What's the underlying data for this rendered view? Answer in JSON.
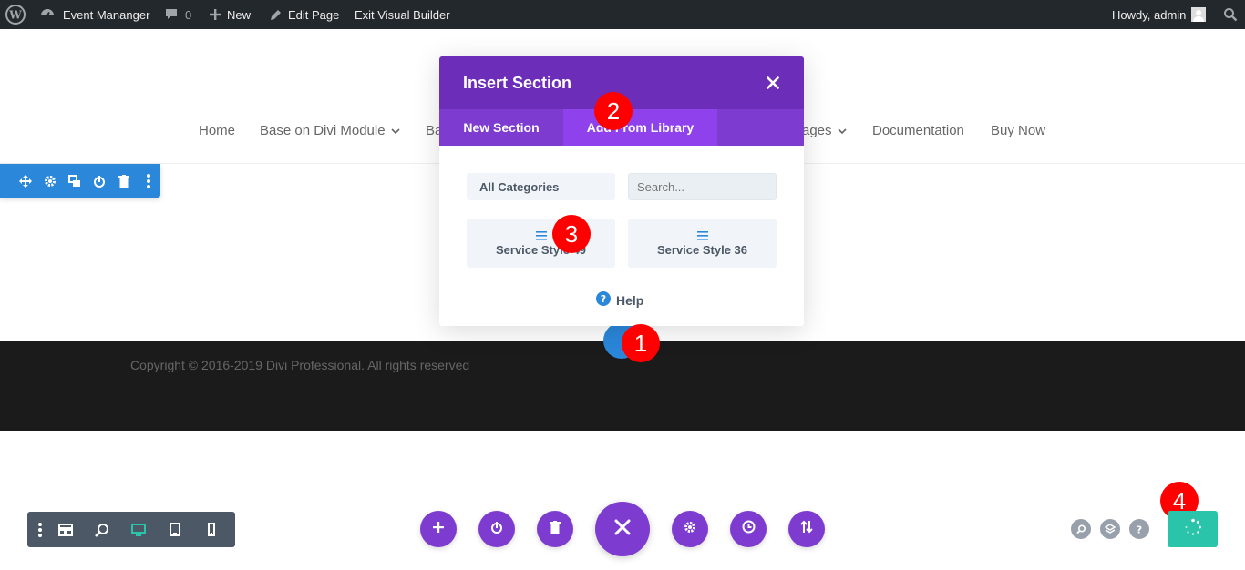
{
  "admin_bar": {
    "site_name": "Event Mananger",
    "comment_count": "0",
    "new_label": "New",
    "edit_label": "Edit Page",
    "exit_label": "Exit Visual Builder",
    "howdy": "Howdy, admin"
  },
  "nav": {
    "items": [
      "Home",
      "Base on Divi Module",
      "Ba",
      "ages",
      "Documentation",
      "Buy Now"
    ]
  },
  "footer": {
    "copyright": "Copyright © 2016-2019 Divi Professional. All rights reserved"
  },
  "modal": {
    "title": "Insert Section",
    "tabs": [
      "New Section",
      "Add From Library"
    ],
    "category_value": "All Categories",
    "search_placeholder": "Search...",
    "library_items": [
      "Service Style 49",
      "Service Style 36"
    ],
    "help_label": "Help"
  },
  "markers": [
    "1",
    "2",
    "3",
    "4"
  ],
  "colors": {
    "admin_bar": "#23282d",
    "divi_purple": "#7d3bcf",
    "modal_header": "#6c2eb9",
    "divi_blue": "#2b87da",
    "save_green": "#29c4a9",
    "marker_red": "#ff0000"
  }
}
